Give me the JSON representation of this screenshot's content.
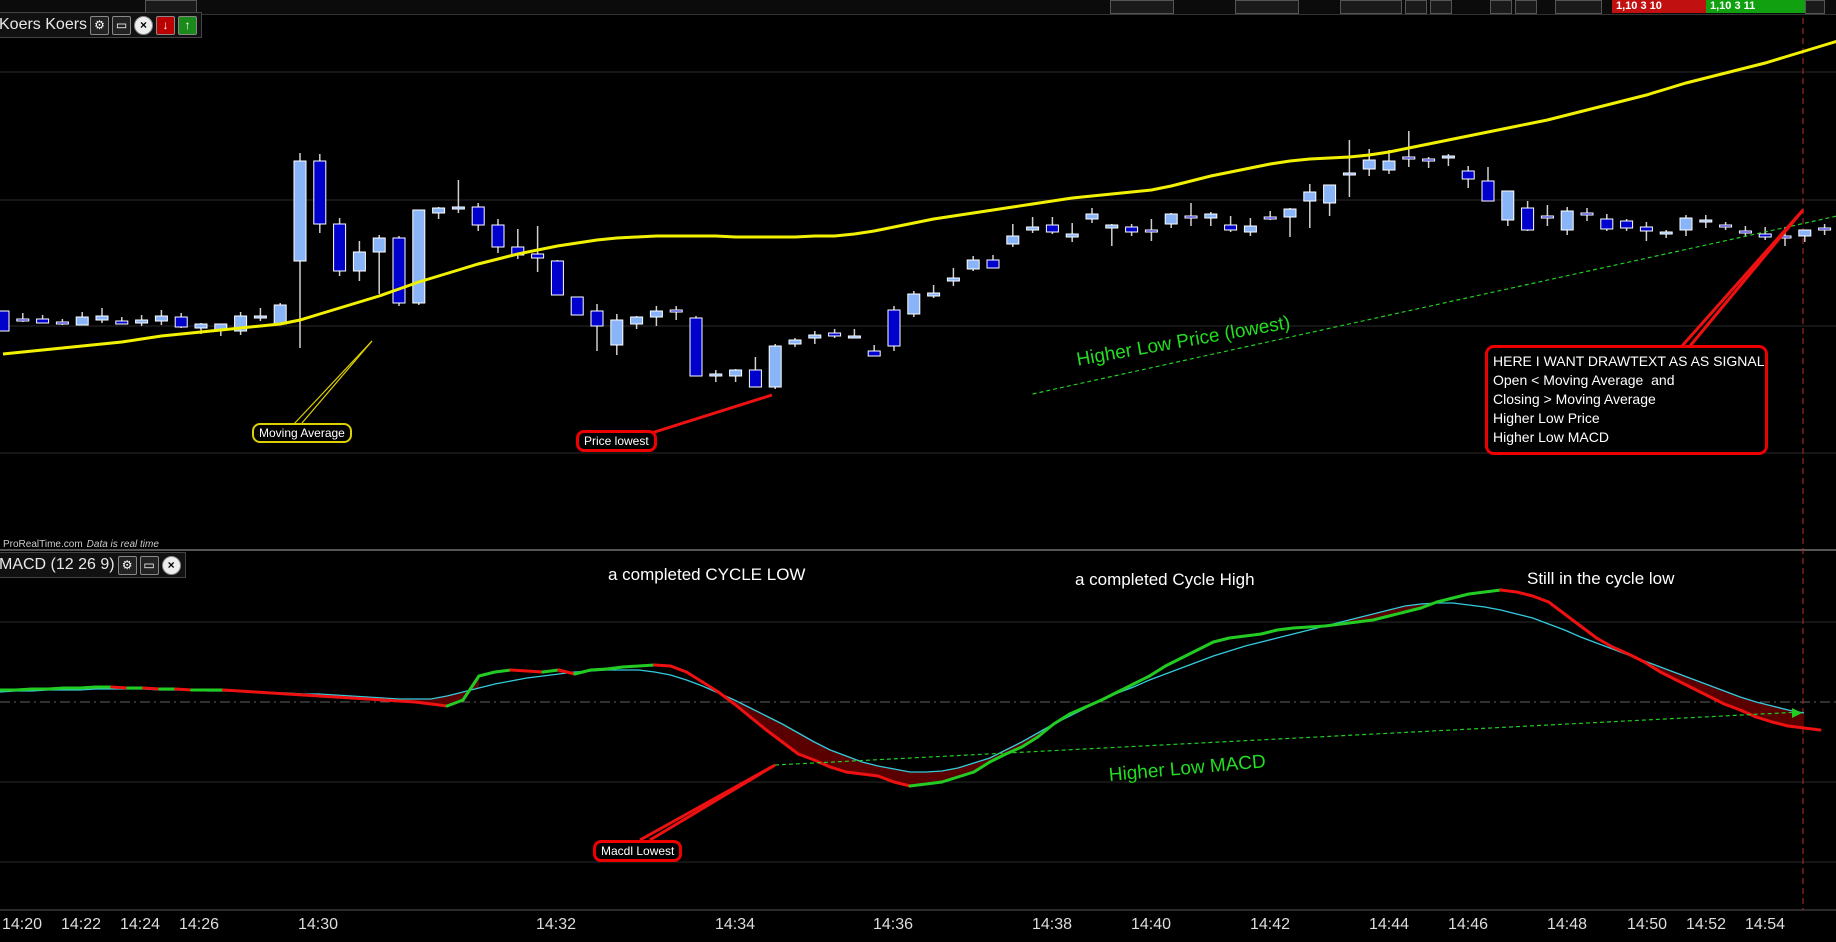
{
  "topbar": {
    "bid_price": "1,10 3 10",
    "ask_price": "1,10 3 11",
    "bid_color": "#c01010",
    "ask_color": "#10a010"
  },
  "price_panel": {
    "title": "Koers Koers",
    "icons": [
      "wrench-icon",
      "window-icon",
      "close-icon",
      "arrow-down-icon",
      "arrow-up-icon"
    ],
    "footer_brand": "ProRealTime.com",
    "footer_status": "Data is real time"
  },
  "macd_panel": {
    "title": "MACD (12 26 9)",
    "icons": [
      "wrench-icon",
      "window-icon",
      "close-icon"
    ]
  },
  "annotations": {
    "moving_average": "Moving Average",
    "price_lowest": "Price lowest",
    "higher_low_price": "Higher Low Price (lowest)",
    "signal_box": [
      "HERE I WANT DRAWTEXT AS AS SIGNAL",
      "Open < Moving Average  and",
      "Closing > Moving Average",
      "Higher Low Price",
      "Higher Low MACD"
    ],
    "cycle_low": "a completed CYCLE LOW",
    "cycle_high": "a completed Cycle High",
    "still_cycle_low": "Still in the cycle low",
    "higher_low_macd": "Higher Low MACD",
    "macd_lowest": "Macdl Lowest"
  },
  "chart_data": [
    {
      "type": "candlestick",
      "title": "Koers Koers",
      "series_colors": {
        "up": "#8ab4f8",
        "down": "#0000cc",
        "moving_average": "#f2f200"
      },
      "x_ticks": [
        "14:20",
        "14:22",
        "14:24",
        "14:26",
        "14:30",
        "14:32",
        "14:34",
        "14:36",
        "14:38",
        "14:40",
        "14:42",
        "14:44",
        "14:46",
        "14:48",
        "14:50",
        "14:52",
        "14:54"
      ],
      "grid": true,
      "candles": [
        {
          "o": -5,
          "h": -3,
          "l": 15,
          "c": 15
        },
        {
          "o": 3,
          "h": -3,
          "l": 6,
          "c": 5
        },
        {
          "o": 3,
          "h": -1,
          "l": 6,
          "c": 7
        },
        {
          "o": 6,
          "h": 3,
          "l": 9,
          "c": 8
        },
        {
          "o": 9,
          "h": -4,
          "l": 9,
          "c": 1
        },
        {
          "o": 4,
          "h": -8,
          "l": 7,
          "c": 0
        },
        {
          "o": 5,
          "h": 1,
          "l": 8,
          "c": 8
        },
        {
          "o": 7,
          "h": -1,
          "l": 10,
          "c": 4
        },
        {
          "o": 5,
          "h": -6,
          "l": 9,
          "c": 0
        },
        {
          "o": 1,
          "h": -3,
          "l": 12,
          "c": 11
        },
        {
          "o": 12,
          "h": 7,
          "l": 18,
          "c": 8
        },
        {
          "o": 14,
          "h": 8,
          "l": 20,
          "c": 8
        },
        {
          "o": 15,
          "h": -4,
          "l": 19,
          "c": 0
        },
        {
          "o": 2,
          "h": -8,
          "l": 5,
          "c": 0
        },
        {
          "o": 8,
          "h": -13,
          "l": 8,
          "c": -11
        },
        {
          "o": -55,
          "h": -163,
          "l": 32,
          "c": -155
        },
        {
          "o": -155,
          "h": -162,
          "l": -83,
          "c": -92
        },
        {
          "o": -92,
          "h": -98,
          "l": -40,
          "c": -45
        },
        {
          "o": -45,
          "h": -75,
          "l": -35,
          "c": -64
        },
        {
          "o": -64,
          "h": -81,
          "l": -22,
          "c": -78
        },
        {
          "o": -78,
          "h": -80,
          "l": -10,
          "c": -13
        },
        {
          "o": -13,
          "h": -106,
          "l": -11,
          "c": -106
        },
        {
          "o": -103,
          "h": -109,
          "l": -97,
          "c": -108
        },
        {
          "o": -108,
          "h": -136,
          "l": -103,
          "c": -109
        },
        {
          "o": -109,
          "h": -113,
          "l": -85,
          "c": -91
        },
        {
          "o": -91,
          "h": -97,
          "l": -63,
          "c": -69
        },
        {
          "o": -69,
          "h": -87,
          "l": -57,
          "c": -61
        },
        {
          "o": -62,
          "h": -90,
          "l": -44,
          "c": -58
        },
        {
          "o": -55,
          "h": -56,
          "l": -21,
          "c": -21
        },
        {
          "o": -19,
          "h": -19,
          "l": -1,
          "c": -1
        },
        {
          "o": -5,
          "h": -12,
          "l": 35,
          "c": 10
        },
        {
          "o": 29,
          "h": -2,
          "l": 39,
          "c": 4
        },
        {
          "o": 8,
          "h": 0,
          "l": 13,
          "c": 1
        },
        {
          "o": 1,
          "h": -10,
          "l": 10,
          "c": -5
        },
        {
          "o": -6,
          "h": -10,
          "l": 4,
          "c": -4
        },
        {
          "o": 2,
          "h": 0,
          "l": 60,
          "c": 60
        },
        {
          "o": 60,
          "h": 54,
          "l": 66,
          "c": 58
        },
        {
          "o": 60,
          "h": 53,
          "l": 66,
          "c": 54
        },
        {
          "o": 54,
          "h": 41,
          "l": 71,
          "c": 71
        },
        {
          "o": 71,
          "h": 28,
          "l": 73,
          "c": 30
        },
        {
          "o": 28,
          "h": 22,
          "l": 31,
          "c": 24
        },
        {
          "o": 22,
          "h": 15,
          "l": 28,
          "c": 19
        },
        {
          "o": 17,
          "h": 13,
          "l": 22,
          "c": 20
        },
        {
          "o": 21,
          "h": 13,
          "l": 22,
          "c": 20
        },
        {
          "o": 35,
          "h": 29,
          "l": 40,
          "c": 40
        },
        {
          "o": -6,
          "h": -10,
          "l": 35,
          "c": 30
        },
        {
          "o": -2,
          "h": -25,
          "l": 1,
          "c": -22
        },
        {
          "o": -20,
          "h": -31,
          "l": -18,
          "c": -23
        },
        {
          "o": -35,
          "h": -48,
          "l": -30,
          "c": -38
        },
        {
          "o": -47,
          "h": -60,
          "l": -45,
          "c": -56
        },
        {
          "o": -56,
          "h": -61,
          "l": -48,
          "c": -48
        },
        {
          "o": -72,
          "h": -92,
          "l": -69,
          "c": -80
        },
        {
          "o": -86,
          "h": -99,
          "l": -83,
          "c": -89
        },
        {
          "o": -91,
          "h": -99,
          "l": -82,
          "c": -84
        },
        {
          "o": -79,
          "h": -93,
          "l": -74,
          "c": -82
        },
        {
          "o": -97,
          "h": -108,
          "l": -93,
          "c": -102
        },
        {
          "o": -88,
          "h": -92,
          "l": -70,
          "c": -91
        },
        {
          "o": -89,
          "h": -92,
          "l": -80,
          "c": -84
        },
        {
          "o": -86,
          "h": -97,
          "l": -75,
          "c": -84
        },
        {
          "o": -92,
          "h": -103,
          "l": -88,
          "c": -102
        },
        {
          "o": -100,
          "h": -113,
          "l": -90,
          "c": -100
        },
        {
          "o": -98,
          "h": -104,
          "l": -90,
          "c": -102
        },
        {
          "o": -91,
          "h": -100,
          "l": -84,
          "c": -86
        },
        {
          "o": -84,
          "h": -98,
          "l": -80,
          "c": -90
        },
        {
          "o": -99,
          "h": -105,
          "l": -96,
          "c": -97
        },
        {
          "o": -99,
          "h": -108,
          "l": -79,
          "c": -107
        },
        {
          "o": -115,
          "h": -132,
          "l": -88,
          "c": -124
        },
        {
          "o": -113,
          "h": -124,
          "l": -100,
          "c": -131
        },
        {
          "o": -142,
          "h": -176,
          "l": -119,
          "c": -143
        },
        {
          "o": -147,
          "h": -167,
          "l": -140,
          "c": -156
        },
        {
          "o": -146,
          "h": -166,
          "l": -142,
          "c": -155
        },
        {
          "o": -159,
          "h": -185,
          "l": -149,
          "c": -159
        },
        {
          "o": -157,
          "h": -159,
          "l": -148,
          "c": -156
        },
        {
          "o": -159,
          "h": -162,
          "l": -150,
          "c": -160
        },
        {
          "o": -145,
          "h": -150,
          "l": -128,
          "c": -137
        },
        {
          "o": -135,
          "h": -149,
          "l": -120,
          "c": -115
        },
        {
          "o": -96,
          "h": -125,
          "l": -90,
          "c": -125
        },
        {
          "o": -108,
          "h": -115,
          "l": -85,
          "c": -86
        },
        {
          "o": -100,
          "h": -111,
          "l": -90,
          "c": -98
        },
        {
          "o": -86,
          "h": -109,
          "l": -81,
          "c": -105
        },
        {
          "o": -103,
          "h": -108,
          "l": -95,
          "c": -101
        },
        {
          "o": -97,
          "h": -102,
          "l": -85,
          "c": -87
        },
        {
          "o": -95,
          "h": -97,
          "l": -85,
          "c": -88
        },
        {
          "o": -89,
          "h": -94,
          "l": -75,
          "c": -85
        },
        {
          "o": -82,
          "h": -86,
          "l": -78,
          "c": -84
        },
        {
          "o": -86,
          "h": -101,
          "l": -80,
          "c": -98
        },
        {
          "o": -95,
          "h": -101,
          "l": -88,
          "c": -96
        },
        {
          "o": -91,
          "h": -94,
          "l": -86,
          "c": -89
        },
        {
          "o": -85,
          "h": -90,
          "l": -80,
          "c": -84
        },
        {
          "o": -82,
          "h": -89,
          "l": -76,
          "c": -79
        },
        {
          "o": -80,
          "h": -89,
          "l": -70,
          "c": -79
        },
        {
          "o": -80,
          "h": -83,
          "l": -74,
          "c": -86
        },
        {
          "o": -88,
          "h": -92,
          "l": -81,
          "c": -87
        },
        {
          "o": -91,
          "h": -93,
          "l": -78,
          "c": -83
        }
      ],
      "moving_average": [
        38,
        36,
        34,
        32,
        30,
        28,
        26,
        23,
        20,
        18,
        16,
        14,
        12,
        10,
        8,
        4,
        -2,
        -8,
        -14,
        -20,
        -27,
        -34,
        -40,
        -46,
        -52,
        -57,
        -62,
        -66,
        -70,
        -73,
        -76,
        -78,
        -79,
        -80,
        -80,
        -80,
        -80,
        -79,
        -79,
        -79,
        -79,
        -80,
        -80,
        -82,
        -85,
        -89,
        -93,
        -97,
        -100,
        -103,
        -106,
        -109,
        -112,
        -115,
        -118,
        -120,
        -122,
        -124,
        -126,
        -130,
        -135,
        -140,
        -144,
        -148,
        -152,
        -155,
        -157,
        -158,
        -159,
        -161,
        -164,
        -168,
        -172,
        -176,
        -180,
        -184,
        -188,
        -192,
        -196,
        -201,
        -206,
        -211,
        -216,
        -221,
        -227,
        -233,
        -238,
        -243,
        -248,
        -253,
        -259,
        -265,
        -271,
        -277,
        -283
      ],
      "trendline": {
        "name": "Higher Low Price (lowest)",
        "from": 52,
        "to": 94
      }
    },
    {
      "type": "line",
      "title": "MACD (12 26 9)",
      "series": [
        {
          "name": "MACD",
          "values": [
            12,
            12,
            13,
            13,
            14,
            14,
            15,
            15,
            14,
            14,
            13,
            13,
            12,
            12,
            12,
            11,
            10,
            9,
            8,
            7,
            6,
            5,
            4,
            3,
            2,
            1,
            0,
            -2,
            -4,
            2,
            26,
            30,
            32,
            31,
            30,
            32,
            28,
            32,
            33,
            35,
            36,
            37,
            36,
            30,
            20,
            10,
            -2,
            -15,
            -28,
            -40,
            -52,
            -58,
            -65,
            -70,
            -72,
            -74,
            -80,
            -84,
            -82,
            -80,
            -75,
            -70,
            -60,
            -52,
            -45,
            -35,
            -22,
            -12,
            -5,
            2,
            10,
            18,
            26,
            36,
            44,
            52,
            60,
            64,
            66,
            68,
            72,
            74,
            75,
            76,
            78,
            80,
            82,
            86,
            90,
            94,
            100,
            104,
            108,
            110,
            112,
            110,
            106,
            100,
            88,
            76,
            64,
            55,
            48,
            40,
            30,
            22,
            14,
            6,
            -2,
            -8,
            -15,
            -20,
            -24,
            -26,
            -28
          ]
        },
        {
          "name": "Signal",
          "values": [
            10,
            11,
            11,
            12,
            12,
            12,
            13,
            13,
            13,
            13,
            12,
            12,
            12,
            11,
            11,
            11,
            10,
            9,
            9,
            8,
            8,
            7,
            6,
            5,
            4,
            3,
            3,
            3,
            6,
            10,
            14,
            18,
            21,
            24,
            26,
            28,
            30,
            31,
            32,
            32,
            32,
            30,
            27,
            22,
            16,
            9,
            2,
            -6,
            -14,
            -22,
            -31,
            -40,
            -48,
            -54,
            -60,
            -64,
            -67,
            -70,
            -70,
            -69,
            -66,
            -61,
            -56,
            -48,
            -40,
            -31,
            -22,
            -14,
            -6,
            2,
            9,
            15,
            22,
            28,
            34,
            40,
            46,
            51,
            56,
            60,
            64,
            68,
            72,
            76,
            80,
            84,
            88,
            92,
            96,
            98,
            99,
            99,
            97,
            95,
            92,
            88,
            84,
            78,
            72,
            65,
            59,
            53,
            47,
            41,
            35,
            29,
            23,
            17,
            11,
            5,
            0,
            -4,
            -8,
            -11
          ]
        }
      ],
      "colors": {
        "macd_up": "#22cc22",
        "macd_down": "#ee1111",
        "signal": "#33ccdd",
        "fill": "#5a0000"
      },
      "trendline": {
        "name": "Higher Low MACD"
      }
    }
  ]
}
